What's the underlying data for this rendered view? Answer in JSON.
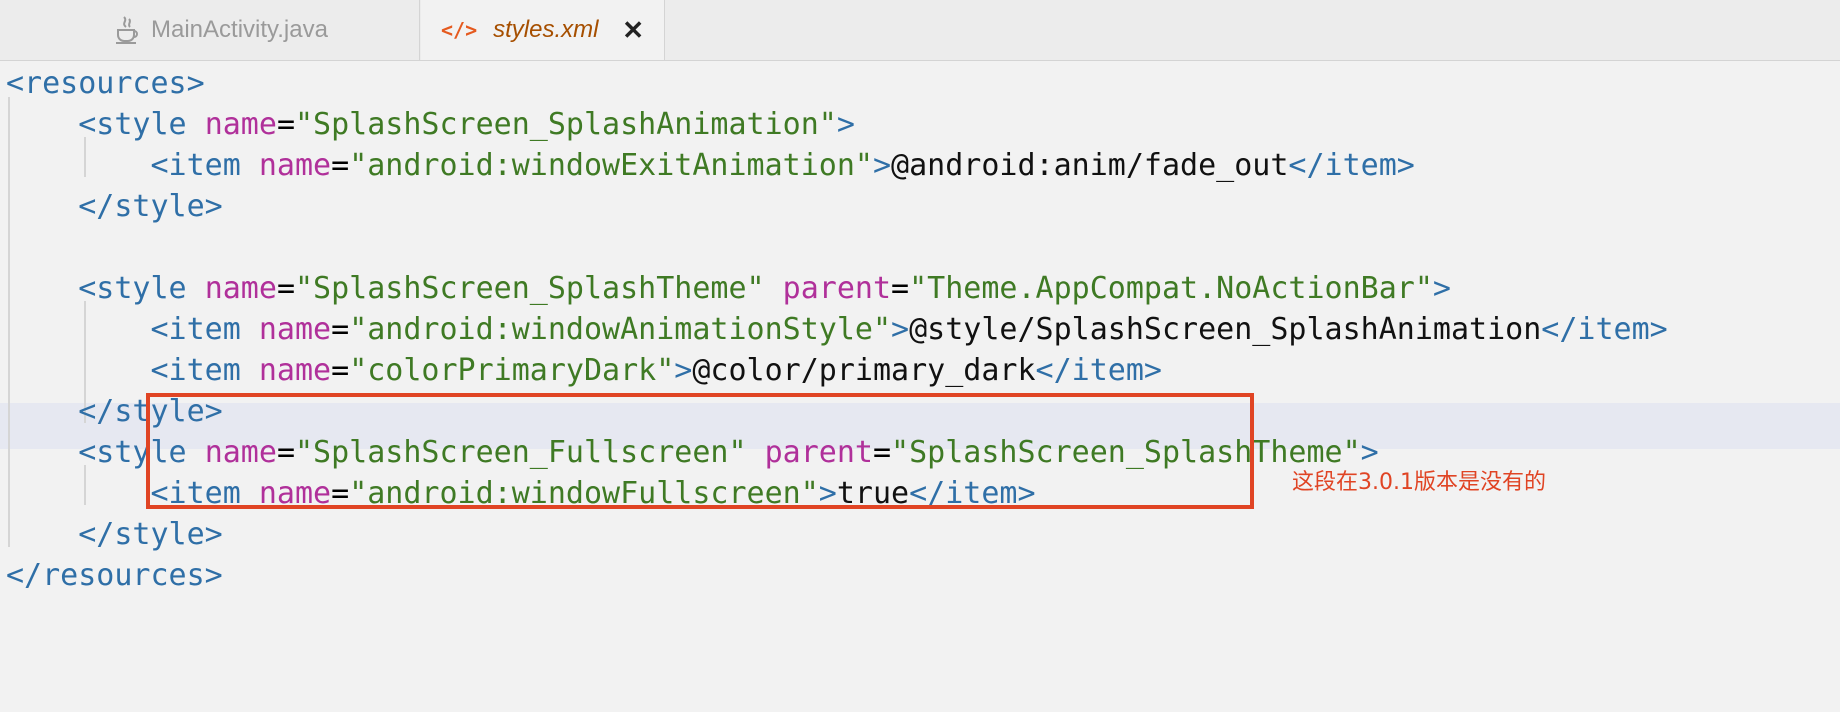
{
  "tabs": [
    {
      "label": "MainActivity.java",
      "icon": "java-file-icon",
      "active": false
    },
    {
      "label": "styles.xml",
      "icon": "code-file-icon",
      "active": true
    }
  ],
  "close_glyph": "✕",
  "lines": [
    {
      "parts": [
        {
          "t": "<resources>",
          "c": "tag"
        }
      ]
    },
    {
      "parts": [
        {
          "t": "    <style ",
          "c": "tag"
        },
        {
          "t": "name",
          "c": "attr"
        },
        {
          "t": "=",
          "c": "eq"
        },
        {
          "t": "\"SplashScreen_SplashAnimation\"",
          "c": "str"
        },
        {
          "t": ">",
          "c": "tag"
        }
      ]
    },
    {
      "parts": [
        {
          "t": "        <item ",
          "c": "tag"
        },
        {
          "t": "name",
          "c": "attr"
        },
        {
          "t": "=",
          "c": "eq"
        },
        {
          "t": "\"android:windowExitAnimation\"",
          "c": "str"
        },
        {
          "t": ">",
          "c": "tag"
        },
        {
          "t": "@android:anim/fade_out",
          "c": "txt"
        },
        {
          "t": "</item>",
          "c": "tag"
        }
      ]
    },
    {
      "parts": [
        {
          "t": "    </style>",
          "c": "tag"
        }
      ]
    },
    {
      "parts": []
    },
    {
      "parts": [
        {
          "t": "    <style ",
          "c": "tag"
        },
        {
          "t": "name",
          "c": "attr"
        },
        {
          "t": "=",
          "c": "eq"
        },
        {
          "t": "\"SplashScreen_SplashTheme\"",
          "c": "str"
        },
        {
          "t": " ",
          "c": "eq"
        },
        {
          "t": "parent",
          "c": "attr"
        },
        {
          "t": "=",
          "c": "eq"
        },
        {
          "t": "\"Theme.AppCompat.NoActionBar\"",
          "c": "str"
        },
        {
          "t": ">",
          "c": "tag"
        }
      ]
    },
    {
      "parts": [
        {
          "t": "        <item ",
          "c": "tag"
        },
        {
          "t": "name",
          "c": "attr"
        },
        {
          "t": "=",
          "c": "eq"
        },
        {
          "t": "\"android:windowAnimationStyle\"",
          "c": "str"
        },
        {
          "t": ">",
          "c": "tag"
        },
        {
          "t": "@style/SplashScreen_SplashAnimation",
          "c": "txt"
        },
        {
          "t": "</item>",
          "c": "tag"
        }
      ]
    },
    {
      "parts": [
        {
          "t": "        <item ",
          "c": "tag"
        },
        {
          "t": "name",
          "c": "attr"
        },
        {
          "t": "=",
          "c": "eq"
        },
        {
          "t": "\"colorPrimaryDark\"",
          "c": "str"
        },
        {
          "t": ">",
          "c": "tag"
        },
        {
          "t": "@color/primary_dark",
          "c": "txt"
        },
        {
          "t": "</item>",
          "c": "tag"
        }
      ],
      "highlight": true
    },
    {
      "parts": [
        {
          "t": "    </style>",
          "c": "tag"
        }
      ]
    },
    {
      "parts": [
        {
          "t": "    <style ",
          "c": "tag"
        },
        {
          "t": "name",
          "c": "attr"
        },
        {
          "t": "=",
          "c": "eq"
        },
        {
          "t": "\"SplashScreen_Fullscreen\"",
          "c": "str"
        },
        {
          "t": " ",
          "c": "eq"
        },
        {
          "t": "parent",
          "c": "attr"
        },
        {
          "t": "=",
          "c": "eq"
        },
        {
          "t": "\"SplashScreen_SplashTheme\"",
          "c": "str"
        },
        {
          "t": ">",
          "c": "tag"
        }
      ]
    },
    {
      "parts": [
        {
          "t": "        <item ",
          "c": "tag"
        },
        {
          "t": "name",
          "c": "attr"
        },
        {
          "t": "=",
          "c": "eq"
        },
        {
          "t": "\"android:windowFullscreen\"",
          "c": "str"
        },
        {
          "t": ">",
          "c": "tag"
        },
        {
          "t": "true",
          "c": "txt"
        },
        {
          "t": "</item>",
          "c": "tag"
        }
      ]
    },
    {
      "parts": [
        {
          "t": "    </style>",
          "c": "tag"
        }
      ]
    },
    {
      "parts": [
        {
          "t": "</resources>",
          "c": "tag"
        }
      ]
    }
  ],
  "annotation": "这段在3.0.1版本是没有的",
  "colors": {
    "tag": "#2f6fa7",
    "attr": "#b0309a",
    "string": "#3f7a24",
    "annotation": "#e04424"
  }
}
